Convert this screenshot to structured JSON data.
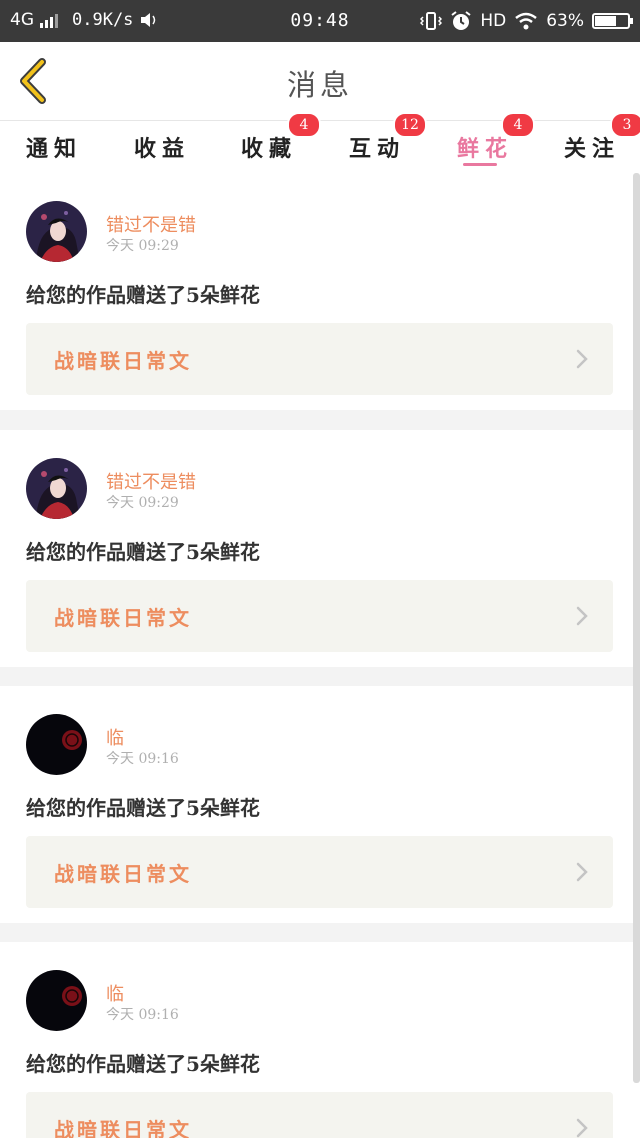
{
  "status_bar": {
    "network": "4G",
    "speed": "0.9K/s",
    "time": "09:48",
    "hd": "HD",
    "battery_text": "63%",
    "battery_level": 0.63
  },
  "nav": {
    "title": "消息"
  },
  "tabs": [
    {
      "label": "通知",
      "badge": ""
    },
    {
      "label": "收益",
      "badge": ""
    },
    {
      "label": "收藏",
      "badge": "4"
    },
    {
      "label": "互动",
      "badge": "12"
    },
    {
      "label": "鲜花",
      "badge": "4",
      "active": true
    },
    {
      "label": "关注",
      "badge": "3"
    }
  ],
  "messages": [
    {
      "user": "错过不是错",
      "time": "今天 09:29",
      "text": "给您的作品赠送了5朵鲜花",
      "work": "战暗联日常文",
      "avatar": "anime-girl"
    },
    {
      "user": "错过不是错",
      "time": "今天 09:29",
      "text": "给您的作品赠送了5朵鲜花",
      "work": "战暗联日常文",
      "avatar": "anime-girl"
    },
    {
      "user": "临",
      "time": "今天 09:16",
      "text": "给您的作品赠送了5朵鲜花",
      "work": "战暗联日常文",
      "avatar": "dark-seal"
    },
    {
      "user": "临",
      "time": "今天 09:16",
      "text": "给您的作品赠送了5朵鲜花",
      "work": "战暗联日常文",
      "avatar": "dark-seal"
    }
  ],
  "colors": {
    "accent_pink": "#e9789f",
    "accent_orange": "#ed8d5f",
    "badge_red": "#f03a44",
    "back_icon_yellow": "#f2c21b"
  }
}
